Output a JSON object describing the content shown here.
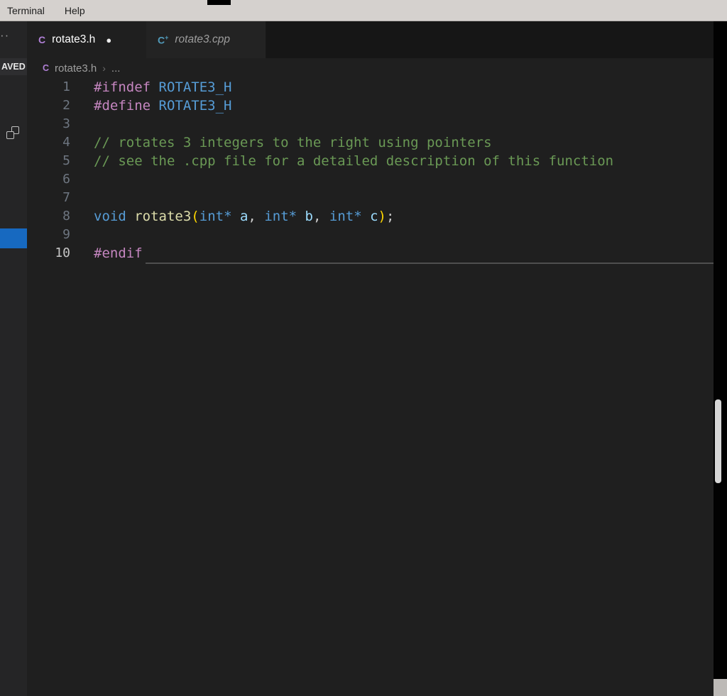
{
  "window": {
    "menu": {
      "items": [
        "Terminal",
        "Help"
      ]
    }
  },
  "sidebar": {
    "overflow_dots": "··",
    "unsaved_badge": "AVED",
    "icons": {
      "split_editor": "split-editor-icon"
    }
  },
  "tabs": {
    "active": {
      "label": "rotate3.h",
      "icon_glyph": "C",
      "modified_dot": "●"
    },
    "preview": {
      "label": "rotate3.cpp",
      "icon_glyph": "C",
      "icon_plus": "+"
    }
  },
  "breadcrumb": {
    "icon_glyph": "C",
    "file": "rotate3.h",
    "separator": "›",
    "more": "..."
  },
  "editor": {
    "language": "c-header",
    "active_line": 10,
    "token_colors": {
      "pp": "#C586C0",
      "macro": "#569CD6",
      "comment": "#6A9955",
      "kw": "#569CD6",
      "fn": "#DCDCAA",
      "paren": "#FFD700",
      "type": "#569CD6",
      "param": "#9CDCFE",
      "plain": "#CCCCCC"
    },
    "lines": [
      {
        "num": 1,
        "tokens": [
          {
            "c": "pp",
            "t": "#ifndef"
          },
          {
            "c": "plain",
            "t": " "
          },
          {
            "c": "macro",
            "t": "ROTATE3_H"
          }
        ]
      },
      {
        "num": 2,
        "tokens": [
          {
            "c": "pp",
            "t": "#define"
          },
          {
            "c": "plain",
            "t": " "
          },
          {
            "c": "macro",
            "t": "ROTATE3_H"
          }
        ]
      },
      {
        "num": 3,
        "tokens": []
      },
      {
        "num": 4,
        "tokens": [
          {
            "c": "comment",
            "t": "// rotates 3 integers to the right using pointers"
          }
        ]
      },
      {
        "num": 5,
        "tokens": [
          {
            "c": "comment",
            "t": "// see the .cpp file for a detailed description of this function"
          }
        ]
      },
      {
        "num": 6,
        "tokens": []
      },
      {
        "num": 7,
        "tokens": []
      },
      {
        "num": 8,
        "tokens": [
          {
            "c": "kw",
            "t": "void"
          },
          {
            "c": "plain",
            "t": " "
          },
          {
            "c": "fn",
            "t": "rotate3"
          },
          {
            "c": "paren",
            "t": "("
          },
          {
            "c": "type",
            "t": "int*"
          },
          {
            "c": "plain",
            "t": " "
          },
          {
            "c": "param",
            "t": "a"
          },
          {
            "c": "plain",
            "t": ", "
          },
          {
            "c": "type",
            "t": "int*"
          },
          {
            "c": "plain",
            "t": " "
          },
          {
            "c": "param",
            "t": "b"
          },
          {
            "c": "plain",
            "t": ", "
          },
          {
            "c": "type",
            "t": "int*"
          },
          {
            "c": "plain",
            "t": " "
          },
          {
            "c": "param",
            "t": "c"
          },
          {
            "c": "paren",
            "t": ")"
          },
          {
            "c": "plain",
            "t": ";"
          }
        ]
      },
      {
        "num": 9,
        "tokens": []
      },
      {
        "num": 10,
        "tokens": [
          {
            "c": "pp",
            "t": "#endif"
          }
        ]
      }
    ]
  },
  "colors": {
    "editor_bg": "#1F1F1F",
    "menu_bg": "#D5D1CE",
    "tab_active_text": "#FFFFFF",
    "tab_inactive_text": "#9D9D9D",
    "line_number": "#6E7681",
    "line_number_active": "#C6C6C6",
    "selection_blue": "#1769C0",
    "scrollbar_thumb": "#D6D6D6"
  }
}
